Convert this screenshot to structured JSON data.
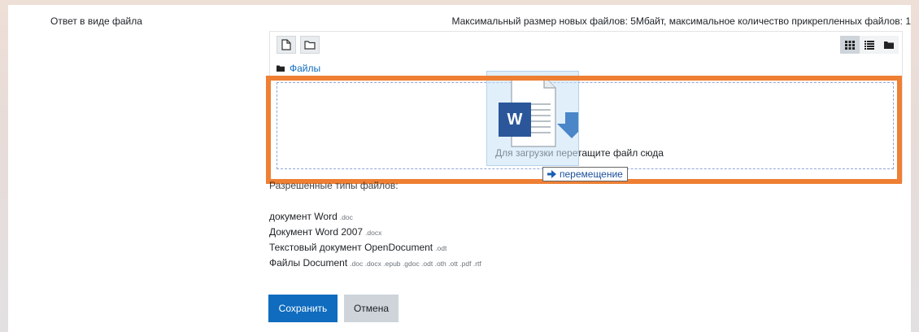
{
  "form": {
    "field_label": "Ответ в виде файла",
    "limits_text": "Максимальный размер новых файлов: 5Мбайт, максимальное количество прикрепленных файлов: 1"
  },
  "filemanager": {
    "toolbar": {
      "add_file_icon": "file-icon",
      "create_folder_icon": "folder-icon"
    },
    "view_modes": [
      "grid-icon",
      "list-icon",
      "folder-tree-icon"
    ],
    "active_view": "grid-icon",
    "breadcrumb": "Файлы",
    "drop_text": "Для загрузки перетащите файл сюда"
  },
  "drag": {
    "file_badge": "W",
    "tooltip": "перемещение"
  },
  "accepted": {
    "heading": "Разрешенные типы файлов:",
    "items": [
      {
        "name": "документ Word",
        "ext": ".doc"
      },
      {
        "name": "Документ Word 2007",
        "ext": ".docx"
      },
      {
        "name": "Текстовый документ OpenDocument",
        "ext": ".odt"
      },
      {
        "name": "Файлы Document",
        "ext": ".doc .docx .epub .gdoc .odt .oth .ott .pdf .rtf"
      }
    ]
  },
  "buttons": {
    "save": "Сохранить",
    "cancel": "Отмена"
  },
  "colors": {
    "highlight": "#ef7f33",
    "primary": "#0f6cbf",
    "word_blue": "#2b579a"
  }
}
